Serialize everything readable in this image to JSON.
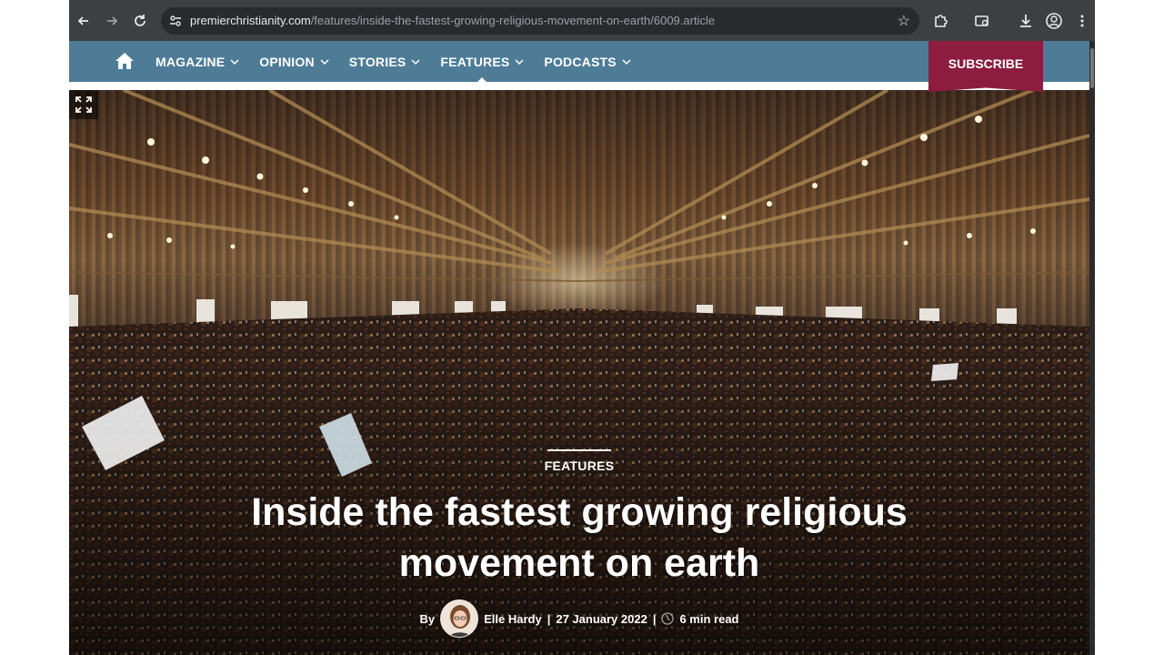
{
  "browser": {
    "url_host": "premierchristianity.com",
    "url_path": "/features/inside-the-fastest-growing-religious-movement-on-earth/6009.article"
  },
  "site_nav": {
    "items": [
      {
        "label": "MAGAZINE"
      },
      {
        "label": "OPINION"
      },
      {
        "label": "STORIES"
      },
      {
        "label": "FEATURES",
        "active": true
      },
      {
        "label": "PODCASTS"
      }
    ],
    "subscribe_label": "SUBSCRIBE",
    "nav_color": "#4e7c97",
    "subscribe_color": "#8c1d40"
  },
  "article": {
    "kicker": "FEATURES",
    "title": "Inside the fastest growing religious movement on earth",
    "byline_prefix": "By",
    "author": "Elle Hardy",
    "date": "27 January 2022",
    "read_time": "6 min read"
  },
  "icons": {
    "back": "arrow-left-icon",
    "forward": "arrow-right-icon",
    "reload": "reload-icon",
    "bookmark": "star-icon",
    "extensions": "puzzle-icon",
    "downloads": "download-icon",
    "profile": "profile-icon",
    "menu": "kebab-menu-icon",
    "home": "home-icon",
    "expand": "expand-icon",
    "clock": "clock-icon"
  }
}
